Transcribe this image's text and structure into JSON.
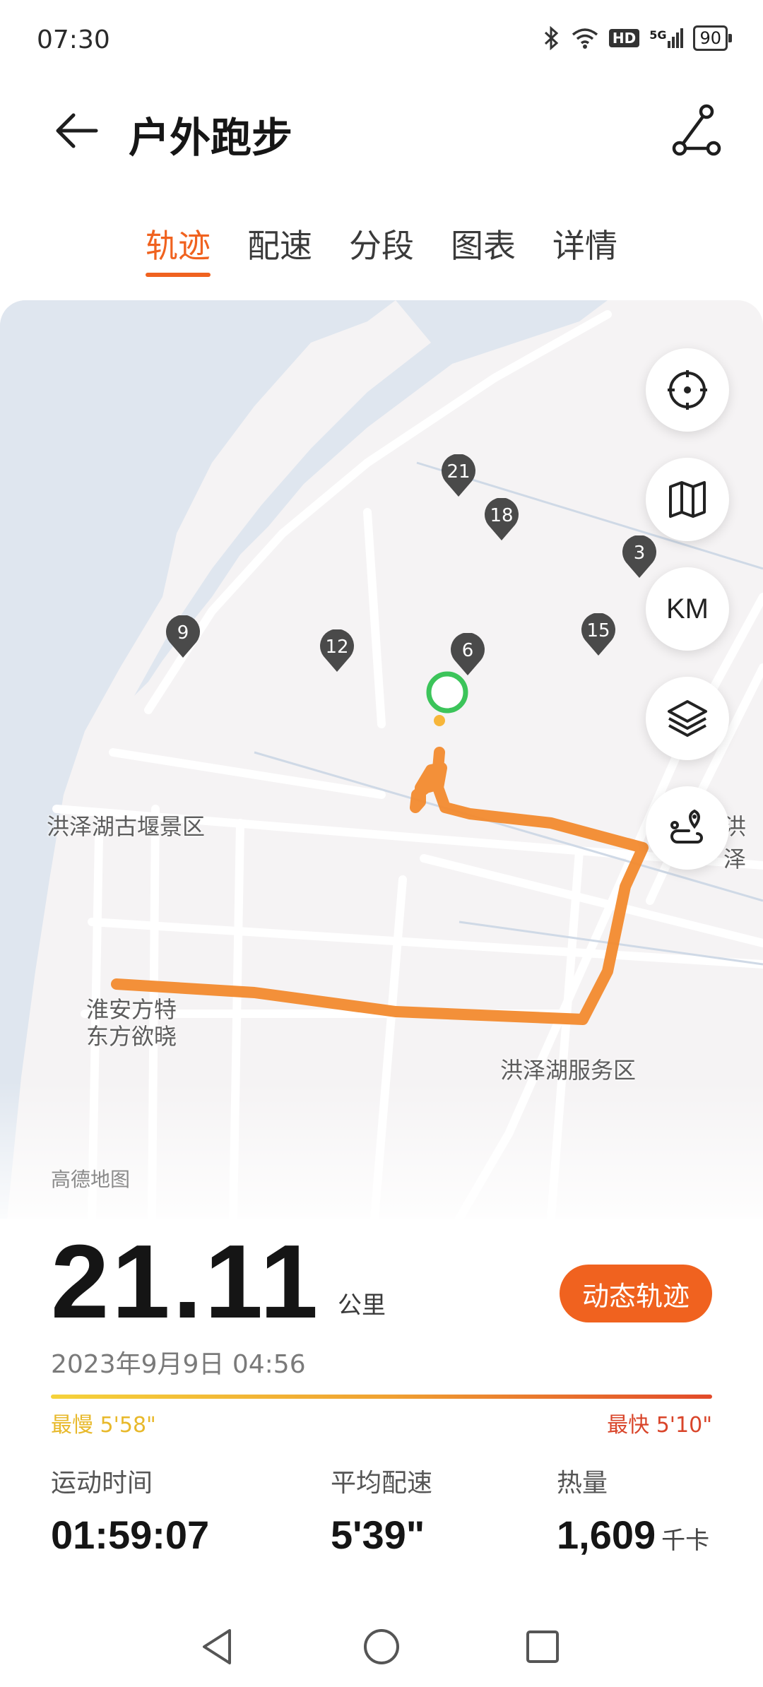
{
  "status_bar": {
    "time": "07:30",
    "network": "5G",
    "hd": "HD",
    "battery": "90"
  },
  "header": {
    "title": "户外跑步"
  },
  "tabs": [
    "轨迹",
    "配速",
    "分段",
    "图表",
    "详情"
  ],
  "active_tab": "轨迹",
  "map": {
    "labels": {
      "scenic_area": "洪泽湖古堰景区",
      "right_edge": "洪泽",
      "hotel": "淮安方特\n东方欲晓",
      "service_area": "洪泽湖服务区"
    },
    "km_markers": [
      "21",
      "18",
      "3",
      "15",
      "9",
      "12",
      "6"
    ],
    "controls": {
      "km_label": "KM"
    },
    "provider": "高德地图",
    "colors": {
      "route": "#f28a2e",
      "start_marker": "#3cc45a",
      "water": "#dfe6ef"
    }
  },
  "summary": {
    "distance": "21.11",
    "distance_unit": "公里",
    "replay_button": "动态轨迹",
    "datetime": "2023年9月9日 04:56",
    "slowest": "最慢 5'58\"",
    "fastest": "最快 5'10\""
  },
  "metrics": [
    {
      "label": "运动时间",
      "value": "01:59:07",
      "unit": ""
    },
    {
      "label": "平均配速",
      "value": "5'39\"",
      "unit": ""
    },
    {
      "label": "热量",
      "value": "1,609",
      "unit": "千卡"
    }
  ],
  "accent_color": "#f0621f"
}
